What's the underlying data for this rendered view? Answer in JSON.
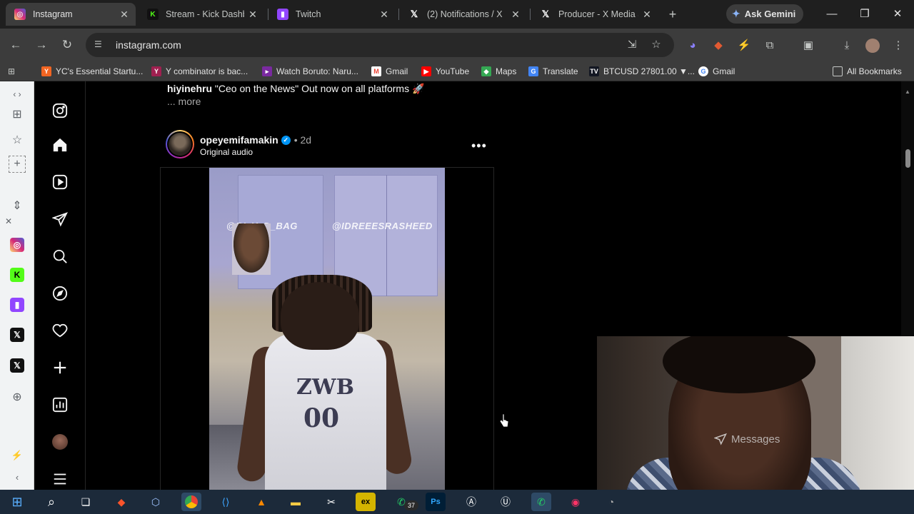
{
  "browser": {
    "tabs": [
      {
        "title": "Instagram",
        "active": true
      },
      {
        "title": "Stream - Kick Dashbo"
      },
      {
        "title": "Twitch"
      },
      {
        "title": "(2) Notifications / X"
      },
      {
        "title": "Producer - X Media S"
      }
    ],
    "ask_gemini": "Ask Gemini",
    "url": "instagram.com",
    "bookmarks": [
      {
        "label": "YC's Essential Startu..."
      },
      {
        "label": "Y combinator is bac..."
      },
      {
        "label": "Watch Boruto: Naru..."
      },
      {
        "label": "Gmail"
      },
      {
        "label": "YouTube"
      },
      {
        "label": "Maps"
      },
      {
        "label": "Translate"
      },
      {
        "label": "BTCUSD 27801.00 ▼..."
      },
      {
        "label": "Gmail"
      }
    ],
    "all_bookmarks": "All Bookmarks"
  },
  "post_prev": {
    "caption_user": "hiyinehru",
    "caption_text": "\"Ceo on the News\" Out now on all platforms 🚀",
    "more": "... more"
  },
  "post": {
    "username": "opeyemifamakin",
    "time": "• 2d",
    "audio": "Original audio",
    "watermark_left": "@BI_Y_D_BAG",
    "watermark_right": "@IDREEESRASHEED",
    "jersey_text": "ZWB",
    "jersey_number": "00"
  },
  "overlay": {
    "messages": "Messages"
  },
  "taskbar": {
    "whatsapp_badge": "37"
  },
  "colors": {
    "ig_gradient": "#d62976",
    "verified": "#0095f6",
    "bg": "#000000"
  }
}
